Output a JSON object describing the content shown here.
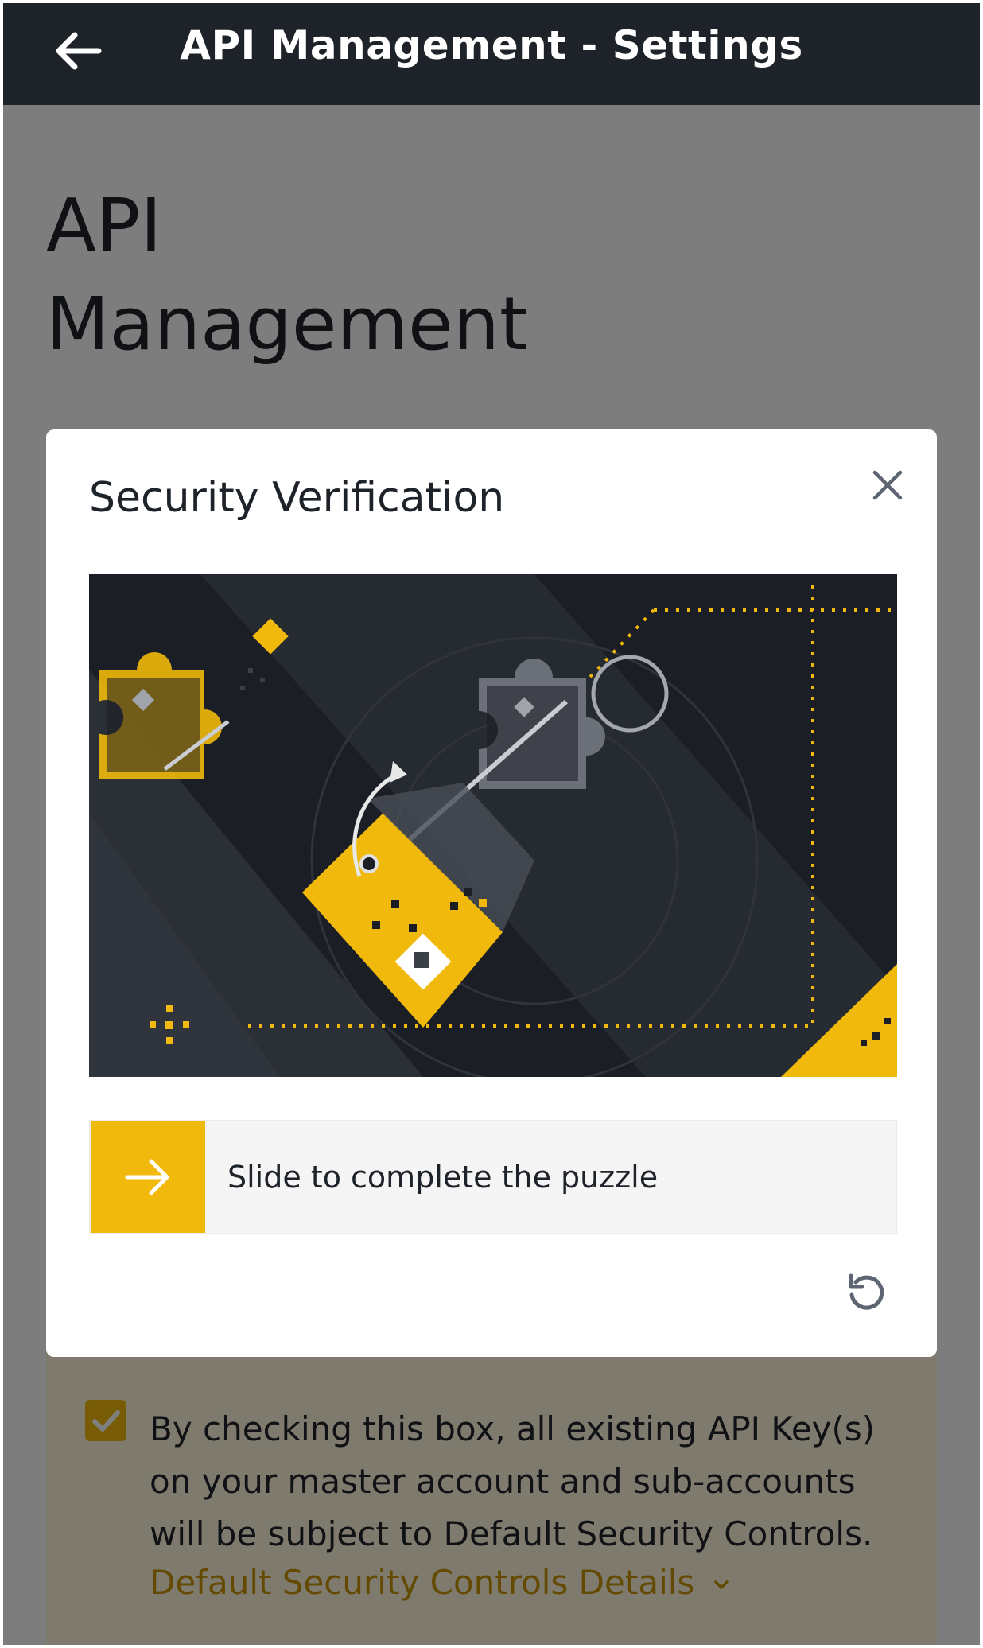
{
  "header": {
    "title": "API Management - Settings",
    "back_icon": "arrow-left-icon"
  },
  "page": {
    "title": "API Management"
  },
  "modal": {
    "title": "Security Verification",
    "close_icon": "close-icon",
    "slider_label": "Slide to complete the puzzle",
    "slider_icon": "arrow-right-icon",
    "refresh_icon": "refresh-icon"
  },
  "terms": {
    "checked": true,
    "text": "By checking this box, all existing API Key(s) on your master account and sub-accounts will be subject to Default Security Controls.",
    "link_label": "Default Security Controls Details",
    "link_icon": "chevron-down-icon"
  },
  "colors": {
    "accent": "#f0b90b",
    "topbar": "#1e2329",
    "link": "#c99400"
  }
}
